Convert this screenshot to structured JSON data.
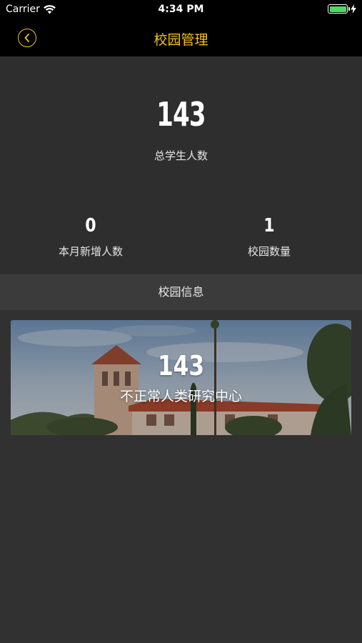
{
  "status_bar": {
    "carrier": "Carrier",
    "time": "4:34 PM",
    "battery_level": 1.0
  },
  "nav": {
    "title": "校园管理",
    "back_icon": "chevron-left-circle-icon",
    "accent_color": "#f1c21a"
  },
  "stats": {
    "total_students": "143",
    "total_students_label": "总学生人数",
    "new_this_month": "0",
    "new_this_month_label": "本月新增人数",
    "campus_count": "1",
    "campus_count_label": "校园数量"
  },
  "section": {
    "title": "校园信息"
  },
  "campuses": [
    {
      "student_count": "143",
      "name": "不正常人类研究中心"
    }
  ]
}
